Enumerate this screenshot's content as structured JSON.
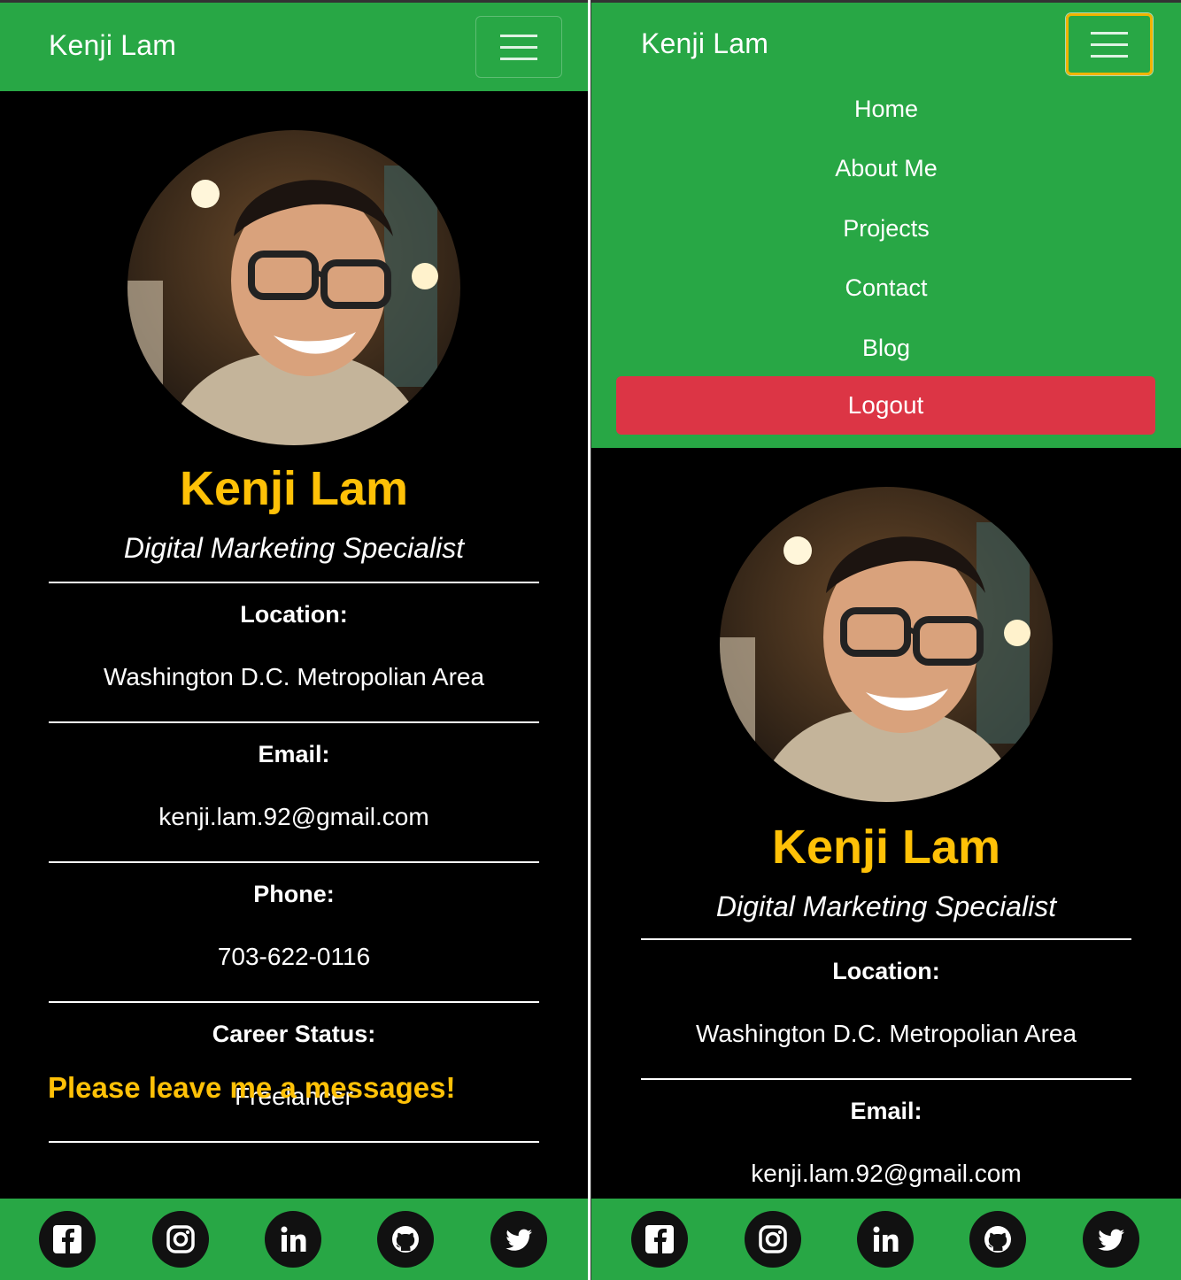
{
  "brand": "Kenji Lam",
  "menu": {
    "items": [
      "Home",
      "About Me",
      "Projects",
      "Contact",
      "Blog"
    ],
    "logout": "Logout"
  },
  "profile": {
    "name": "Kenji Lam",
    "title": "Digital Marketing Specialist",
    "location_label": "Location:",
    "location": "Washington D.C. Metropolian Area",
    "email_label": "Email:",
    "email": "kenji.lam.92@gmail.com",
    "phone_label": "Phone:",
    "phone": "703-622-0116",
    "career_label": "Career Status:",
    "career": "Freelancer",
    "cta": "Please leave me a messages!"
  },
  "social_icons": [
    "facebook-icon",
    "instagram-icon",
    "linkedin-icon",
    "github-icon",
    "twitter-icon"
  ],
  "colors": {
    "navbar": "#28a745",
    "accent": "#ffc107",
    "logout": "#dc3545",
    "background": "#000000"
  }
}
